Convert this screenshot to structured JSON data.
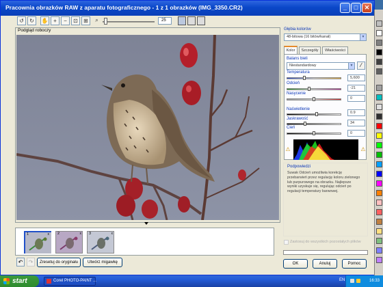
{
  "window": {
    "title": "Pracownia obrazków RAW z aparatu fotograficznego - 1 z 1 obrazków (IMG_3350.CR2)",
    "minimize": "_",
    "maximize": "□",
    "close": "✕"
  },
  "toolbar": {
    "icons": [
      "rotate-left-icon",
      "rotate-right-icon",
      "hand-pan-icon",
      "zoom-in-icon",
      "zoom-out-icon",
      "zoom-fit-icon",
      "zoom-100-icon",
      "magnifier-icon"
    ],
    "zoom_value": "25",
    "zoom_level_fraction": 0.25
  },
  "preview": {
    "label": "Podgląd roboczy"
  },
  "thumbnails": [
    {
      "num": "1",
      "close": "x"
    },
    {
      "num": "2",
      "close": "x"
    },
    {
      "num": "3",
      "close": "x"
    }
  ],
  "bottom": {
    "reset_label": "Zresetuj do oryginału",
    "snapshot_label": "Utwórz migawkę"
  },
  "right_panel": {
    "depth_label": "Głębia kolorów",
    "depth_value": "48-bitowa (16 bitów/kanał)",
    "tabs": [
      "Kolor",
      "Szczegóły",
      "Właściwości"
    ],
    "white_balance_label": "Balans bieli",
    "white_balance_value": "Niestandardowy",
    "temperature_label": "Temperatura",
    "temperature_value": "5,600",
    "tint_label": "Odcień",
    "tint_value": "-21",
    "saturation_label": "Nasycenie",
    "saturation_value": "0",
    "exposure_label": "Naświetlenie",
    "exposure_value": "0.9",
    "brightness_label": "Jaskrawość",
    "brightness_value": "34",
    "shadows_label": "Cień",
    "shadows_value": "0",
    "hint_title": "Podpowiedzi",
    "hint_text": "Suwak Odcień umożliwia korekcję przebarwień przez regulację koloru zielonego lub purpurowego na obrazku. Najlepsze wyniki uzyskuje się, regulując odcień po regulacji temperatury barwowej.",
    "apply_all_label": "Zastosuj do wszystkich pozostałych plików"
  },
  "buttons": {
    "ok": "OK",
    "cancel": "Anuluj",
    "help": "Pomoc"
  },
  "taskbar": {
    "start": "start",
    "task_label": "Corel PHOTO-PAINT ...",
    "lang": "EN",
    "clock": "16:33"
  },
  "colors": {
    "title_bar": "#0a47c8",
    "accent_tab": "#e68b2c",
    "hint_title": "#0a36b8"
  }
}
